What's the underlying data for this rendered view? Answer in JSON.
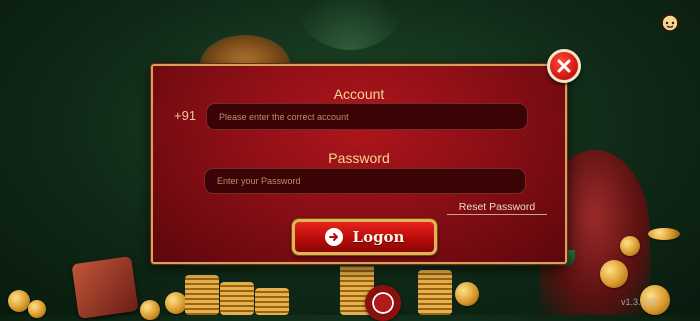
{
  "dialog": {
    "account_label": "Account",
    "country_code": "+91",
    "account_placeholder": "Please enter the correct account",
    "password_label": "Password",
    "password_placeholder": "Enter your Password",
    "reset_password": "Reset Password",
    "logon_label": "Logon"
  },
  "footer": {
    "version": "v1.3.1(0)"
  },
  "icons": {
    "close": "close-icon",
    "support": "support-chat-icon",
    "logon_arrow": "arrow-right-icon"
  },
  "colors": {
    "dialog_bg": "#8c0f16",
    "dialog_border": "#d7a15a",
    "label": "#f4d892",
    "button": "#d51a14"
  }
}
